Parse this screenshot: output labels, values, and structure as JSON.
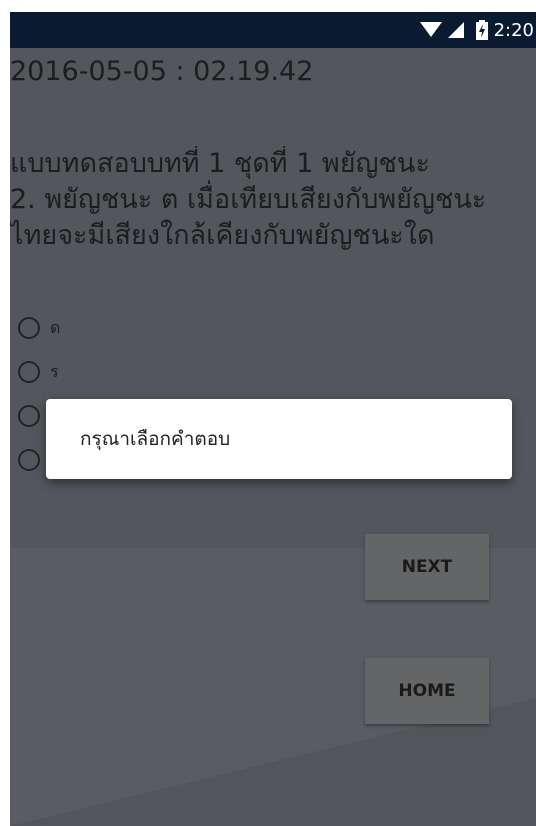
{
  "status_bar": {
    "time": "2:20",
    "icons": [
      "wifi-icon",
      "signal-icon",
      "battery-charging-icon"
    ],
    "background": "#0a1a30"
  },
  "quiz": {
    "timestamp": "2016-05-05 : 02.19.42",
    "question_lines": [
      "แบบทดสอบบทที่ 1 ชุดที่ 1 พยัญชนะ",
      "2. พยัญชนะ ต เมื่อเทียบเสียงกับพยัญชนะ",
      "ไทยจะมีเสียงใกล้เคียงกับพยัญชนะใด"
    ],
    "options": [
      "ด",
      "ร",
      "",
      ""
    ]
  },
  "buttons": {
    "next_label": "NEXT",
    "home_label": "HOME"
  },
  "toast": {
    "message": "กรุณาเลือกคำตอบ"
  }
}
